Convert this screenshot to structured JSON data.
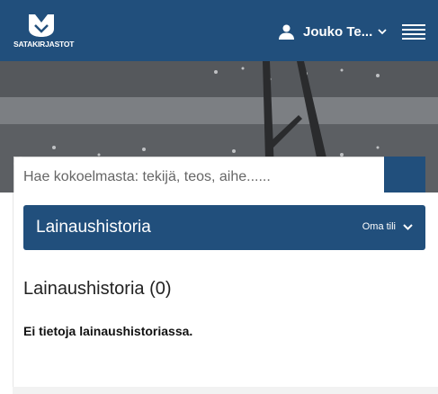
{
  "header": {
    "brand": "SATAKIRJASTOT",
    "user_name": "Jouko Te...",
    "colors": {
      "primary": "#214f7c"
    }
  },
  "search": {
    "placeholder": "Hae kokoelmasta: tekijä, teos, aihe......",
    "value": ""
  },
  "section": {
    "title": "Lainaushistoria",
    "account_menu_label": "Oma tili"
  },
  "main": {
    "heading": "Lainaushistoria (0)",
    "empty_message": "Ei tietoja lainaushistoriassa."
  },
  "icons": [
    "library-logo",
    "user-icon",
    "chevron-down-icon",
    "hamburger-menu-icon",
    "search-icon"
  ]
}
